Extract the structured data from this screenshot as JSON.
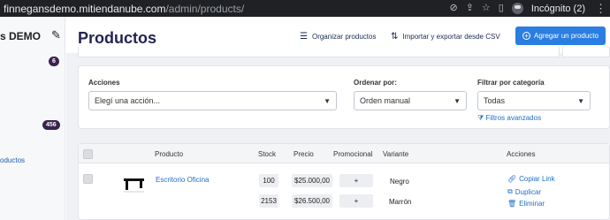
{
  "browser": {
    "url_host": "finnegansdemo.mitiendanube.com",
    "url_path": "/admin/products/",
    "profile_label": "Incógnito (2)"
  },
  "sidebar": {
    "store_name": "s DEMO",
    "badge_1": "6",
    "badge_2": "456",
    "link_label": "oductos"
  },
  "header": {
    "title": "Productos",
    "organize_label": "Organizar productos",
    "import_export_label": "Importar y exportar desde CSV",
    "add_button_label": "Agregar un producto"
  },
  "filters": {
    "actions_label": "Acciones",
    "actions_value": "Elegí una acción...",
    "sort_label": "Ordenar por:",
    "sort_value": "Orden manual",
    "category_label": "Filtrar por categoría",
    "category_value": "Todas",
    "advanced_label": "Filtros avanzados"
  },
  "table": {
    "headers": {
      "product": "Producto",
      "stock": "Stock",
      "price": "Precio",
      "promo": "Promocional",
      "variant": "Variante",
      "actions": "Acciones"
    },
    "product": {
      "name": "Escritorio Oficina",
      "variants": [
        {
          "stock": "100",
          "price": "$25.000,00",
          "promo": "+",
          "variant": "Negro"
        },
        {
          "stock": "2153",
          "price": "$26.500,00",
          "promo": "+",
          "variant": "Marrón"
        }
      ],
      "actions": {
        "copy": "Copiar Link",
        "duplicate": "Duplicar",
        "delete": "Eliminar"
      }
    }
  },
  "colors": {
    "primary_button": "#2a7de1",
    "link": "#1e6fc7",
    "title": "#232355",
    "badge": "#3b2350"
  }
}
